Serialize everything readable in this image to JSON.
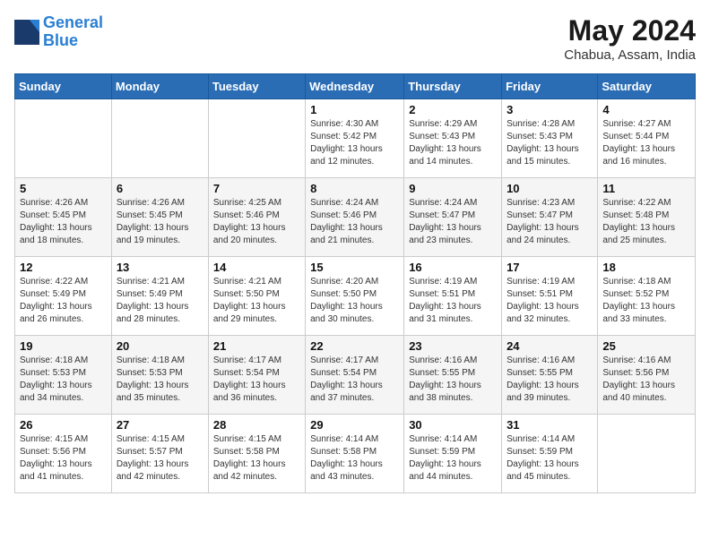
{
  "logo": {
    "line1": "General",
    "line2": "Blue"
  },
  "title": "May 2024",
  "location": "Chabua, Assam, India",
  "days_header": [
    "Sunday",
    "Monday",
    "Tuesday",
    "Wednesday",
    "Thursday",
    "Friday",
    "Saturday"
  ],
  "weeks": [
    [
      {
        "day": "",
        "sunrise": "",
        "sunset": "",
        "daylight": ""
      },
      {
        "day": "",
        "sunrise": "",
        "sunset": "",
        "daylight": ""
      },
      {
        "day": "",
        "sunrise": "",
        "sunset": "",
        "daylight": ""
      },
      {
        "day": "1",
        "sunrise": "Sunrise: 4:30 AM",
        "sunset": "Sunset: 5:42 PM",
        "daylight": "Daylight: 13 hours and 12 minutes."
      },
      {
        "day": "2",
        "sunrise": "Sunrise: 4:29 AM",
        "sunset": "Sunset: 5:43 PM",
        "daylight": "Daylight: 13 hours and 14 minutes."
      },
      {
        "day": "3",
        "sunrise": "Sunrise: 4:28 AM",
        "sunset": "Sunset: 5:43 PM",
        "daylight": "Daylight: 13 hours and 15 minutes."
      },
      {
        "day": "4",
        "sunrise": "Sunrise: 4:27 AM",
        "sunset": "Sunset: 5:44 PM",
        "daylight": "Daylight: 13 hours and 16 minutes."
      }
    ],
    [
      {
        "day": "5",
        "sunrise": "Sunrise: 4:26 AM",
        "sunset": "Sunset: 5:45 PM",
        "daylight": "Daylight: 13 hours and 18 minutes."
      },
      {
        "day": "6",
        "sunrise": "Sunrise: 4:26 AM",
        "sunset": "Sunset: 5:45 PM",
        "daylight": "Daylight: 13 hours and 19 minutes."
      },
      {
        "day": "7",
        "sunrise": "Sunrise: 4:25 AM",
        "sunset": "Sunset: 5:46 PM",
        "daylight": "Daylight: 13 hours and 20 minutes."
      },
      {
        "day": "8",
        "sunrise": "Sunrise: 4:24 AM",
        "sunset": "Sunset: 5:46 PM",
        "daylight": "Daylight: 13 hours and 21 minutes."
      },
      {
        "day": "9",
        "sunrise": "Sunrise: 4:24 AM",
        "sunset": "Sunset: 5:47 PM",
        "daylight": "Daylight: 13 hours and 23 minutes."
      },
      {
        "day": "10",
        "sunrise": "Sunrise: 4:23 AM",
        "sunset": "Sunset: 5:47 PM",
        "daylight": "Daylight: 13 hours and 24 minutes."
      },
      {
        "day": "11",
        "sunrise": "Sunrise: 4:22 AM",
        "sunset": "Sunset: 5:48 PM",
        "daylight": "Daylight: 13 hours and 25 minutes."
      }
    ],
    [
      {
        "day": "12",
        "sunrise": "Sunrise: 4:22 AM",
        "sunset": "Sunset: 5:49 PM",
        "daylight": "Daylight: 13 hours and 26 minutes."
      },
      {
        "day": "13",
        "sunrise": "Sunrise: 4:21 AM",
        "sunset": "Sunset: 5:49 PM",
        "daylight": "Daylight: 13 hours and 28 minutes."
      },
      {
        "day": "14",
        "sunrise": "Sunrise: 4:21 AM",
        "sunset": "Sunset: 5:50 PM",
        "daylight": "Daylight: 13 hours and 29 minutes."
      },
      {
        "day": "15",
        "sunrise": "Sunrise: 4:20 AM",
        "sunset": "Sunset: 5:50 PM",
        "daylight": "Daylight: 13 hours and 30 minutes."
      },
      {
        "day": "16",
        "sunrise": "Sunrise: 4:19 AM",
        "sunset": "Sunset: 5:51 PM",
        "daylight": "Daylight: 13 hours and 31 minutes."
      },
      {
        "day": "17",
        "sunrise": "Sunrise: 4:19 AM",
        "sunset": "Sunset: 5:51 PM",
        "daylight": "Daylight: 13 hours and 32 minutes."
      },
      {
        "day": "18",
        "sunrise": "Sunrise: 4:18 AM",
        "sunset": "Sunset: 5:52 PM",
        "daylight": "Daylight: 13 hours and 33 minutes."
      }
    ],
    [
      {
        "day": "19",
        "sunrise": "Sunrise: 4:18 AM",
        "sunset": "Sunset: 5:53 PM",
        "daylight": "Daylight: 13 hours and 34 minutes."
      },
      {
        "day": "20",
        "sunrise": "Sunrise: 4:18 AM",
        "sunset": "Sunset: 5:53 PM",
        "daylight": "Daylight: 13 hours and 35 minutes."
      },
      {
        "day": "21",
        "sunrise": "Sunrise: 4:17 AM",
        "sunset": "Sunset: 5:54 PM",
        "daylight": "Daylight: 13 hours and 36 minutes."
      },
      {
        "day": "22",
        "sunrise": "Sunrise: 4:17 AM",
        "sunset": "Sunset: 5:54 PM",
        "daylight": "Daylight: 13 hours and 37 minutes."
      },
      {
        "day": "23",
        "sunrise": "Sunrise: 4:16 AM",
        "sunset": "Sunset: 5:55 PM",
        "daylight": "Daylight: 13 hours and 38 minutes."
      },
      {
        "day": "24",
        "sunrise": "Sunrise: 4:16 AM",
        "sunset": "Sunset: 5:55 PM",
        "daylight": "Daylight: 13 hours and 39 minutes."
      },
      {
        "day": "25",
        "sunrise": "Sunrise: 4:16 AM",
        "sunset": "Sunset: 5:56 PM",
        "daylight": "Daylight: 13 hours and 40 minutes."
      }
    ],
    [
      {
        "day": "26",
        "sunrise": "Sunrise: 4:15 AM",
        "sunset": "Sunset: 5:56 PM",
        "daylight": "Daylight: 13 hours and 41 minutes."
      },
      {
        "day": "27",
        "sunrise": "Sunrise: 4:15 AM",
        "sunset": "Sunset: 5:57 PM",
        "daylight": "Daylight: 13 hours and 42 minutes."
      },
      {
        "day": "28",
        "sunrise": "Sunrise: 4:15 AM",
        "sunset": "Sunset: 5:58 PM",
        "daylight": "Daylight: 13 hours and 42 minutes."
      },
      {
        "day": "29",
        "sunrise": "Sunrise: 4:14 AM",
        "sunset": "Sunset: 5:58 PM",
        "daylight": "Daylight: 13 hours and 43 minutes."
      },
      {
        "day": "30",
        "sunrise": "Sunrise: 4:14 AM",
        "sunset": "Sunset: 5:59 PM",
        "daylight": "Daylight: 13 hours and 44 minutes."
      },
      {
        "day": "31",
        "sunrise": "Sunrise: 4:14 AM",
        "sunset": "Sunset: 5:59 PM",
        "daylight": "Daylight: 13 hours and 45 minutes."
      },
      {
        "day": "",
        "sunrise": "",
        "sunset": "",
        "daylight": ""
      }
    ]
  ]
}
